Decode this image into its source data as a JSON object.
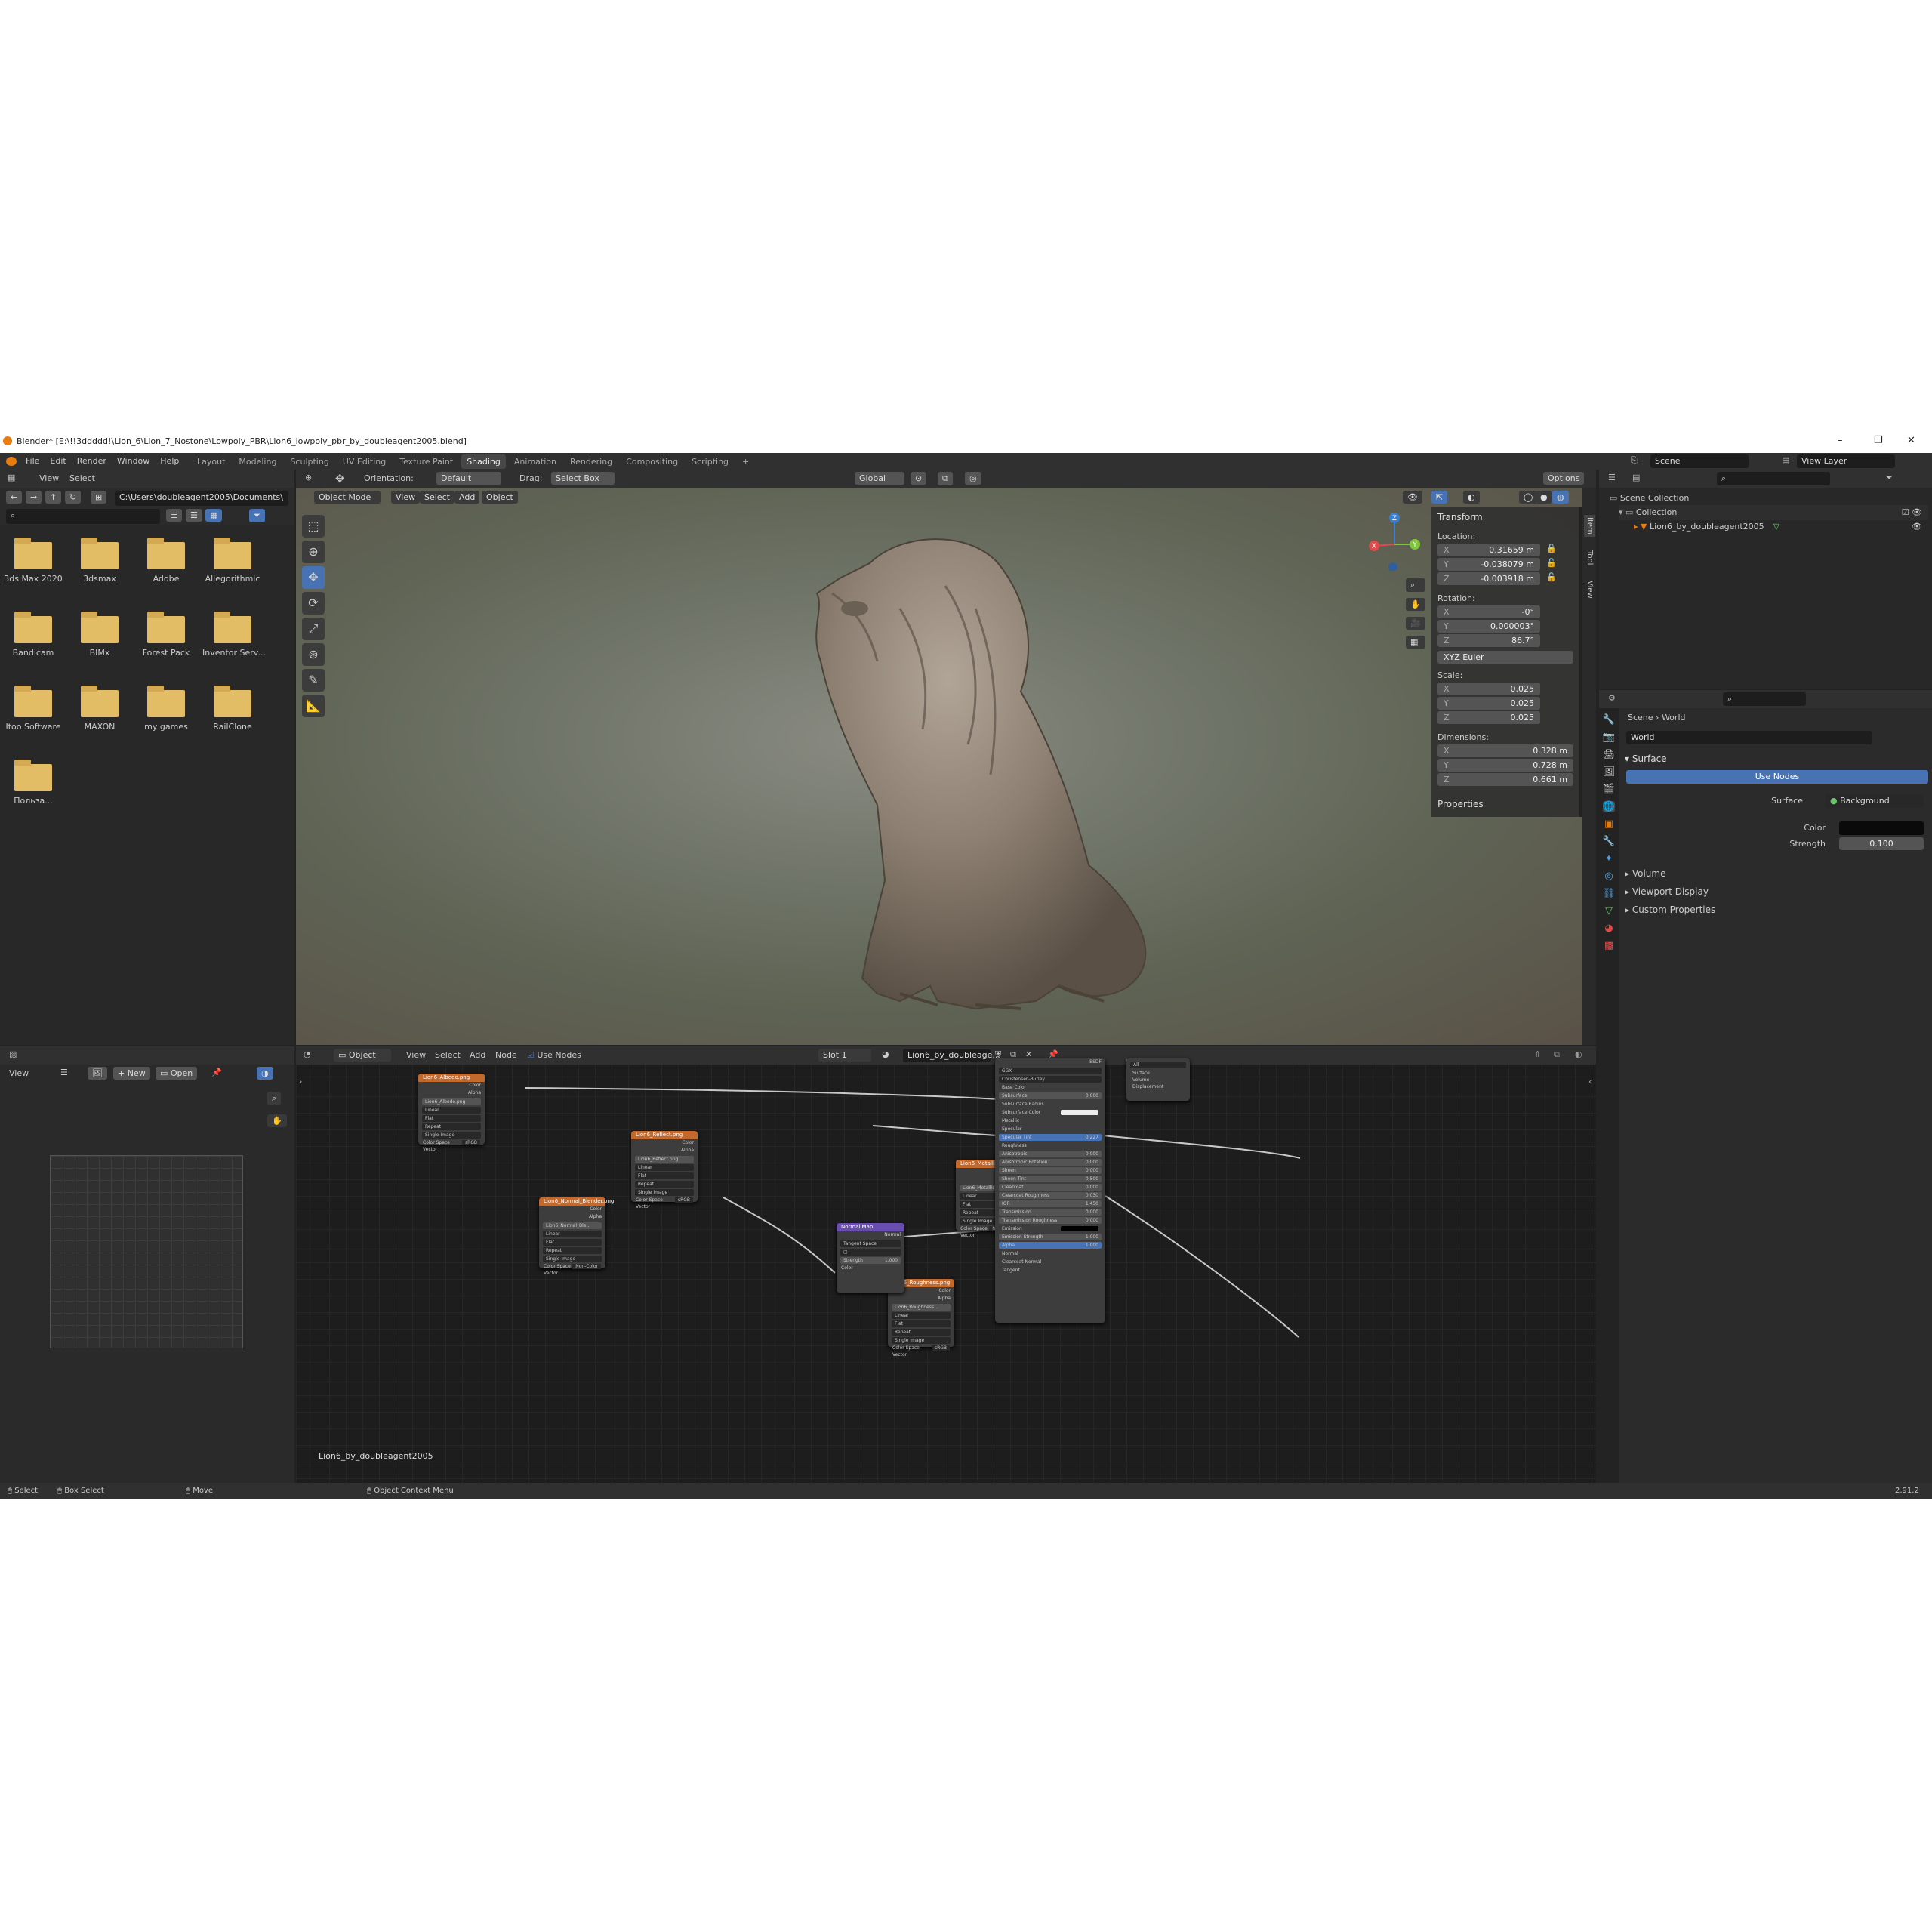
{
  "window": {
    "title": "Blender* [E:\\!!3ddddd!\\Lion_6\\Lion_7_Nostone\\Lowpoly_PBR\\Lion6_lowpoly_pbr_by_doubleagent2005.blend]",
    "min": "–",
    "max": "❐",
    "close": "✕"
  },
  "menu": [
    "File",
    "Edit",
    "Render",
    "Window",
    "Help"
  ],
  "workspaces": [
    "Layout",
    "Modeling",
    "Sculpting",
    "UV Editing",
    "Texture Paint",
    "Shading",
    "Animation",
    "Rendering",
    "Compositing",
    "Scripting",
    "+"
  ],
  "active_workspace": "Shading",
  "topright": {
    "scene": "Scene",
    "view_layer": "View Layer"
  },
  "filebrowser": {
    "menu": [
      "View",
      "Select"
    ],
    "path": "C:\\Users\\doubleagent2005\\Documents\\",
    "folders": [
      "3ds Max 2020",
      "3dsmax",
      "Adobe",
      "Allegorithmic",
      "Bandicam",
      "BIMx",
      "Forest Pack",
      "Inventor Serv...",
      "Itoo Software",
      "MAXON",
      "my games",
      "RailClone",
      "Польза..."
    ],
    "folder_color": "#e3bd66"
  },
  "viewport_header": {
    "orientation_label": "Orientation:",
    "orientation": "Default",
    "drag_label": "Drag:",
    "drag": "Select Box",
    "transform": "Global",
    "options": "Options"
  },
  "viewport_sub": {
    "mode": "Object Mode",
    "menu": [
      "View",
      "Select",
      "Add",
      "Object"
    ]
  },
  "transform": {
    "title": "Transform",
    "location_label": "Location:",
    "location": {
      "x": "0.31659 m",
      "y": "-0.038079 m",
      "z": "-0.003918 m"
    },
    "rotation_label": "Rotation:",
    "rotation": {
      "x": "-0°",
      "y": "0.000003°",
      "z": "86.7°"
    },
    "rotation_mode": "XYZ Euler",
    "scale_label": "Scale:",
    "scale": {
      "x": "0.025",
      "y": "0.025",
      "z": "0.025"
    },
    "dimensions_label": "Dimensions:",
    "dimensions": {
      "x": "0.328 m",
      "y": "0.728 m",
      "z": "0.661 m"
    },
    "properties": "Properties",
    "axis_x": "X",
    "axis_y": "Y",
    "axis_z": "Z"
  },
  "side_tabs": [
    "Item",
    "Tool",
    "View"
  ],
  "outliner": {
    "scene_collection": "Scene Collection",
    "collection": "Collection",
    "object": "Lion6_by_doubleagent2005"
  },
  "properties": {
    "breadcrumb": [
      "Scene",
      "World"
    ],
    "world_name": "World",
    "surface_section": "Surface",
    "use_nodes": "Use Nodes",
    "surface_label": "Surface",
    "surface_value": "Background",
    "color_label": "Color",
    "strength_label": "Strength",
    "strength_value": "0.100",
    "sections": [
      "Volume",
      "Viewport Display",
      "Custom Properties"
    ]
  },
  "image_editor": {
    "view": "View",
    "new": "New",
    "open": "Open"
  },
  "node_editor": {
    "object": "Object",
    "menu": [
      "View",
      "Select",
      "Add",
      "Node"
    ],
    "use_nodes": "Use Nodes",
    "slot": "Slot 1",
    "material": "Lion6_by_doubleage...",
    "footer": "Lion6_by_doubleagent2005",
    "nodes": [
      {
        "title": "Lion6_Albedo.png",
        "file": "Lion6_Albedo.png",
        "outs": [
          "Color",
          "Alpha"
        ],
        "rows": [
          "Linear",
          "Flat",
          "Repeat",
          "Single Image"
        ],
        "cs": "sRGB",
        "color": "#c26a2e"
      },
      {
        "title": "Lion6_Reflect.png",
        "file": "Lion6_Reflect.png",
        "outs": [
          "Color",
          "Alpha"
        ],
        "rows": [
          "Linear",
          "Flat",
          "Repeat",
          "Single Image"
        ],
        "cs": "sRGB",
        "color": "#c26a2e"
      },
      {
        "title": "Lion6_Normal_Blender.png",
        "file": "Lion6_Normal_Ble...",
        "outs": [
          "Color",
          "Alpha"
        ],
        "rows": [
          "Linear",
          "Flat",
          "Repeat",
          "Single Image"
        ],
        "cs": "Non-Color",
        "color": "#c26a2e"
      },
      {
        "title": "Lion6_Metallic.png",
        "file": "Lion6_Metallic.png",
        "outs": [
          "Color",
          "Alpha"
        ],
        "rows": [
          "Linear",
          "Flat",
          "Repeat",
          "Single Image"
        ],
        "cs": "Non-Color",
        "color": "#c26a2e"
      },
      {
        "title": "Lion6_Roughness.png",
        "file": "Lion6_Roughness...",
        "outs": [
          "Color",
          "Alpha"
        ],
        "rows": [
          "Linear",
          "Flat",
          "Repeat",
          "Single Image"
        ],
        "cs": "sRGB",
        "color": "#c26a2e"
      }
    ],
    "color_space_label": "Color Space",
    "vector_label": "Vector",
    "normalmap": {
      "title": "Normal Map",
      "out": "Normal",
      "space": "Tangent Space",
      "strength_label": "Strength",
      "strength": "1.000",
      "color": "Color"
    },
    "bsdf": {
      "header": "BSDF",
      "dist": "GGX",
      "ss": "Christensen-Burley",
      "rows": [
        "Base Color",
        "Subsurface",
        "Subsurface Radius",
        "Subsurface Color",
        "Metallic",
        "Specular",
        "Specular Tint",
        "Roughness",
        "Anisotropic",
        "Anisotropic Rotation",
        "Sheen",
        "Sheen Tint",
        "Clearcoat",
        "Clearcoat Roughness",
        "IOR",
        "Transmission",
        "Transmission Roughness",
        "Emission",
        "Emission Strength",
        "Alpha",
        "Normal",
        "Clearcoat Normal",
        "Tangent"
      ],
      "values": [
        "",
        "0.000",
        "",
        "",
        "",
        "",
        "0.227",
        "",
        "0.000",
        "0.000",
        "0.000",
        "0.500",
        "0.000",
        "0.030",
        "1.450",
        "0.000",
        "0.000",
        "",
        "1.000",
        "1.000",
        "",
        "",
        ""
      ]
    },
    "output": {
      "target": "All",
      "rows": [
        "Surface",
        "Volume",
        "Displacement"
      ]
    }
  },
  "statusbar": {
    "select": "Select",
    "box_select": "Box Select",
    "move": "Move",
    "context": "Object Context Menu",
    "version": "2.91.2"
  }
}
